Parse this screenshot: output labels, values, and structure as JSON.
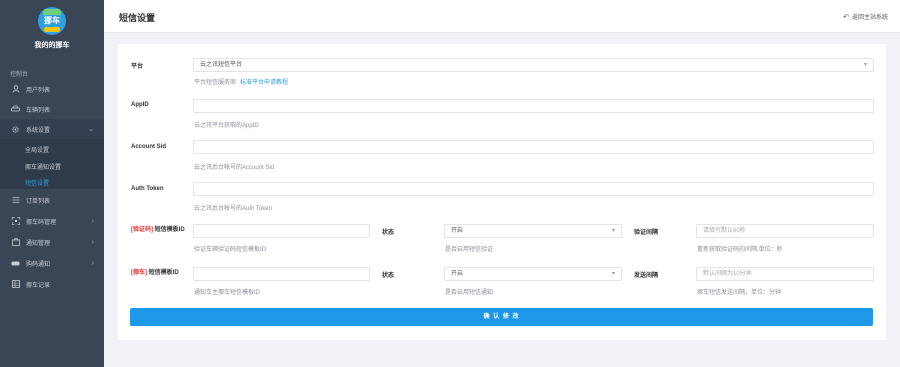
{
  "sidebar": {
    "logo_text": "挪车",
    "brand": "我的的挪车",
    "section": "控制台",
    "items": [
      {
        "label": "用户列表",
        "icon": "user-icon"
      },
      {
        "label": "车辆列表",
        "icon": "car-icon"
      },
      {
        "label": "系统设置",
        "icon": "gear-icon"
      },
      {
        "label": "订单列表",
        "icon": "list-icon"
      },
      {
        "label": "挪车码管理",
        "icon": "qrcode-icon"
      },
      {
        "label": "通知管理",
        "icon": "bell-icon"
      },
      {
        "label": "购码通知",
        "icon": "cart-icon"
      },
      {
        "label": "挪车记录",
        "icon": "record-icon"
      }
    ],
    "sub_items": [
      "全局设置",
      "挪车通知设置",
      "短信设置"
    ]
  },
  "header": {
    "title": "短信设置",
    "back_label": "返回主站系统"
  },
  "form": {
    "platform": {
      "label": "平台",
      "value": "云之讯短信平台",
      "help": "平台短信服务商",
      "help_link": "标准平台申请教程"
    },
    "appid": {
      "label": "AppID",
      "value": "",
      "help": "云之讯平台获取的AppID"
    },
    "account_sid": {
      "label": "Account Sid",
      "value": "",
      "help": "云之讯后台帐号的Account Sid"
    },
    "auth_token": {
      "label": "Auth Token",
      "value": "",
      "help": "云之讯后台帐号的Auth Token"
    },
    "verify_template": {
      "label_tag": "[验证码]",
      "label": "短信模板ID",
      "value": "",
      "help": "验证车辆验证码短信模板ID",
      "status_label": "状态",
      "status_value": "开启",
      "status_help": "是否启用短信验证",
      "interval_label": "验证间隔",
      "interval_placeholder": "请填写默认60秒",
      "interval_help": "重新获取验证码的间隔,单位：秒"
    },
    "notify_template": {
      "label_tag": "[挪车]",
      "label": "短信模板ID",
      "value": "",
      "help": "通知车主挪车短信模板ID",
      "status_label": "状态",
      "status_value": "开启",
      "status_help": "是否启用短信通知",
      "interval_label": "发送间隔",
      "interval_placeholder": "默认间隔为10分钟",
      "interval_help": "挪车短信发送间隔，单位：分钟"
    },
    "submit_label": "确 认 修 改"
  },
  "colors": {
    "sidebar_bg": "#3a4556",
    "accent": "#1e98e8",
    "required": "#e53935"
  }
}
